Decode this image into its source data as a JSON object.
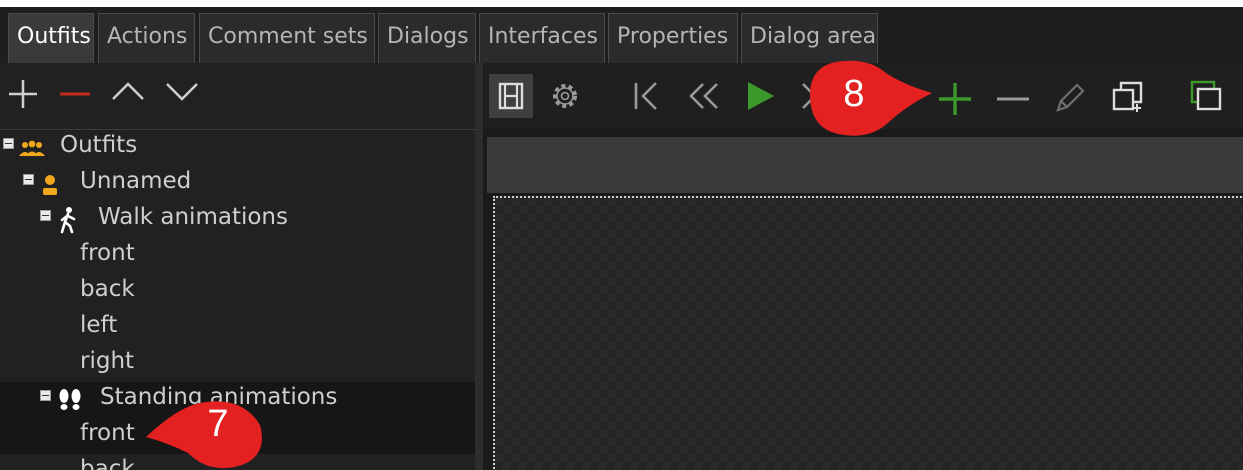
{
  "tabs": [
    {
      "label": "Outfits",
      "active": true
    },
    {
      "label": "Actions"
    },
    {
      "label": "Comment sets"
    },
    {
      "label": "Dialogs"
    },
    {
      "label": "Interfaces"
    },
    {
      "label": "Properties"
    },
    {
      "label": "Dialog area"
    }
  ],
  "left_toolbar": {
    "icons": [
      "plus-icon",
      "minus-icon",
      "chevron-up-icon",
      "chevron-down-icon"
    ],
    "minus_color": "#c42b1c"
  },
  "tree": {
    "root": {
      "label": "Outfits",
      "icon": "group-icon"
    },
    "outfit": {
      "label": "Unnamed",
      "icon": "person-icon"
    },
    "walk": {
      "label": "Walk animations",
      "icon": "walking-icon",
      "items": [
        "front",
        "back",
        "left",
        "right"
      ]
    },
    "standing": {
      "label": "Standing animations",
      "icon": "footprints-icon",
      "items": [
        "front",
        "back"
      ]
    }
  },
  "right_toolbar": {
    "icons": [
      "film-strip-icon",
      "gear-icon",
      "skip-to-start-icon",
      "rewind-icon",
      "play-icon",
      "fast-forward-icon",
      "add-frame-icon",
      "remove-frame-icon",
      "pencil-icon",
      "duplicate-icon",
      "layers-icon"
    ],
    "accent_green": "#3c9a2a"
  },
  "callouts": [
    {
      "number": "7",
      "color": "#e32121"
    },
    {
      "number": "8",
      "color": "#e32121"
    }
  ]
}
